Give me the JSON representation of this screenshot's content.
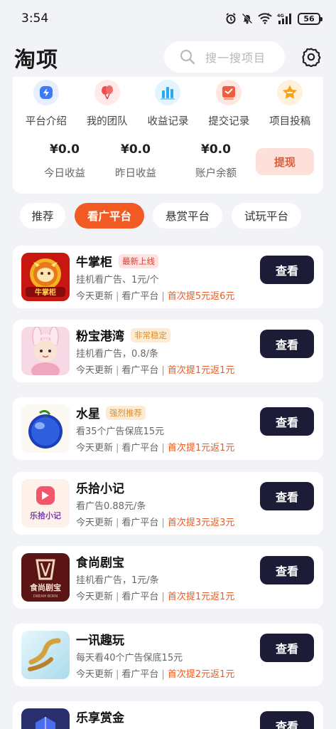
{
  "status_bar": {
    "time": "3:54",
    "signal_label": "4G",
    "battery": "56",
    "wifi_label": "6"
  },
  "header": {
    "title": "淘项",
    "search_placeholder": "搜一搜项目"
  },
  "quick_actions": [
    {
      "label": "平台介绍",
      "icon": "lightning-icon",
      "color": "#3d7bf5"
    },
    {
      "label": "我的团队",
      "icon": "balloon-icon",
      "color": "#ef4e4e"
    },
    {
      "label": "收益记录",
      "icon": "bar-chart-icon",
      "color": "#2aa8f0"
    },
    {
      "label": "提交记录",
      "icon": "submit-icon",
      "color": "#f15a3c"
    },
    {
      "label": "项目投稿",
      "icon": "star-icon",
      "color": "#f7a21b"
    }
  ],
  "earnings": [
    {
      "value": "¥0.0",
      "label": "今日收益"
    },
    {
      "value": "¥0.0",
      "label": "昨日收益"
    },
    {
      "value": "¥0.0",
      "label": "账户余额"
    }
  ],
  "withdraw_label": "提现",
  "tabs": [
    {
      "label": "推荐",
      "active": false
    },
    {
      "label": "看广平台",
      "active": true
    },
    {
      "label": "悬赏平台",
      "active": false
    },
    {
      "label": "试玩平台",
      "active": false
    }
  ],
  "items": [
    {
      "name": "牛掌柜",
      "tag": "最新上线",
      "tag_style": "red",
      "desc": "挂机看广告、1元/个",
      "update": "今天更新",
      "category": "看广平台",
      "promo": "首次提5元返6元",
      "button": "查看",
      "logo_text": "牛掌柜"
    },
    {
      "name": "粉宝港湾",
      "tag": "非常稳定",
      "tag_style": "orange",
      "desc": "挂机看广告，0.8/条",
      "update": "今天更新",
      "category": "看广平台",
      "promo": "首次提1元返1元",
      "button": "查看",
      "logo_text": ""
    },
    {
      "name": "水星",
      "tag": "强烈推荐",
      "tag_style": "orange",
      "desc": "看35个广告保底15元",
      "update": "今天更新",
      "category": "看广平台",
      "promo": "首次提1元返1元",
      "button": "查看",
      "logo_text": ""
    },
    {
      "name": "乐拾小记",
      "tag": "",
      "tag_style": "",
      "desc": "看广告0.88元/条",
      "update": "今天更新",
      "category": "看广平台",
      "promo": "首次提3元返3元",
      "button": "查看",
      "logo_text": "乐拾小记"
    },
    {
      "name": "食尚剧宝",
      "tag": "",
      "tag_style": "",
      "desc": "挂机看广告，1元/条",
      "update": "今天更新",
      "category": "看广平台",
      "promo": "首次提1元返1元",
      "button": "查看",
      "logo_text": "食尚剧宝",
      "logo_subtext": "DREAM BORN"
    },
    {
      "name": "一讯趣玩",
      "tag": "",
      "tag_style": "",
      "desc": "每天看40个广告保底15元",
      "update": "今天更新",
      "category": "看广平台",
      "promo": "首次提2元返1元",
      "button": "查看",
      "logo_text": ""
    },
    {
      "name": "乐享赏金",
      "tag": "",
      "tag_style": "",
      "desc": "",
      "update": "",
      "category": "",
      "promo": "",
      "button": "查看",
      "logo_text": ""
    }
  ]
}
